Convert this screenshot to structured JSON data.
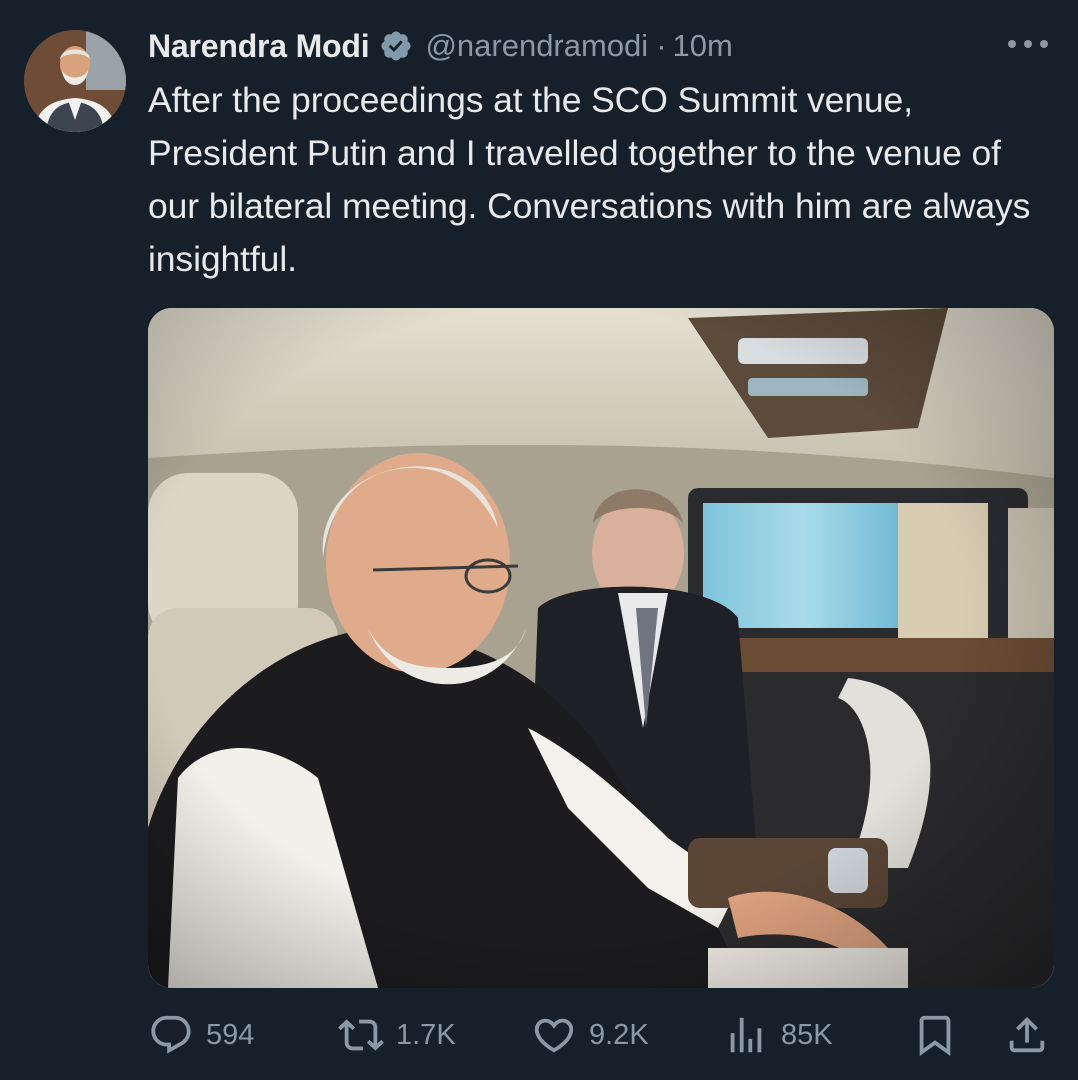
{
  "tweet": {
    "author": {
      "name": "Narendra Modi",
      "handle": "@narendramodi",
      "verified_icon": "verified-badge-icon"
    },
    "separator": "·",
    "timestamp": "10m",
    "text": "After the proceedings at the SCO Summit venue, President Putin and I travelled together to the venue of our bilateral meeting. Conversations with him are always insightful.",
    "media": {
      "description_icon": "photo"
    },
    "actions": {
      "replies": "594",
      "retweets": "1.7K",
      "likes": "9.2K",
      "views": "85K"
    }
  },
  "colors": {
    "background": "#15202b",
    "text_primary": "#e7e9ea",
    "text_secondary": "#8b98a5",
    "verified_badge": "#829aab"
  }
}
